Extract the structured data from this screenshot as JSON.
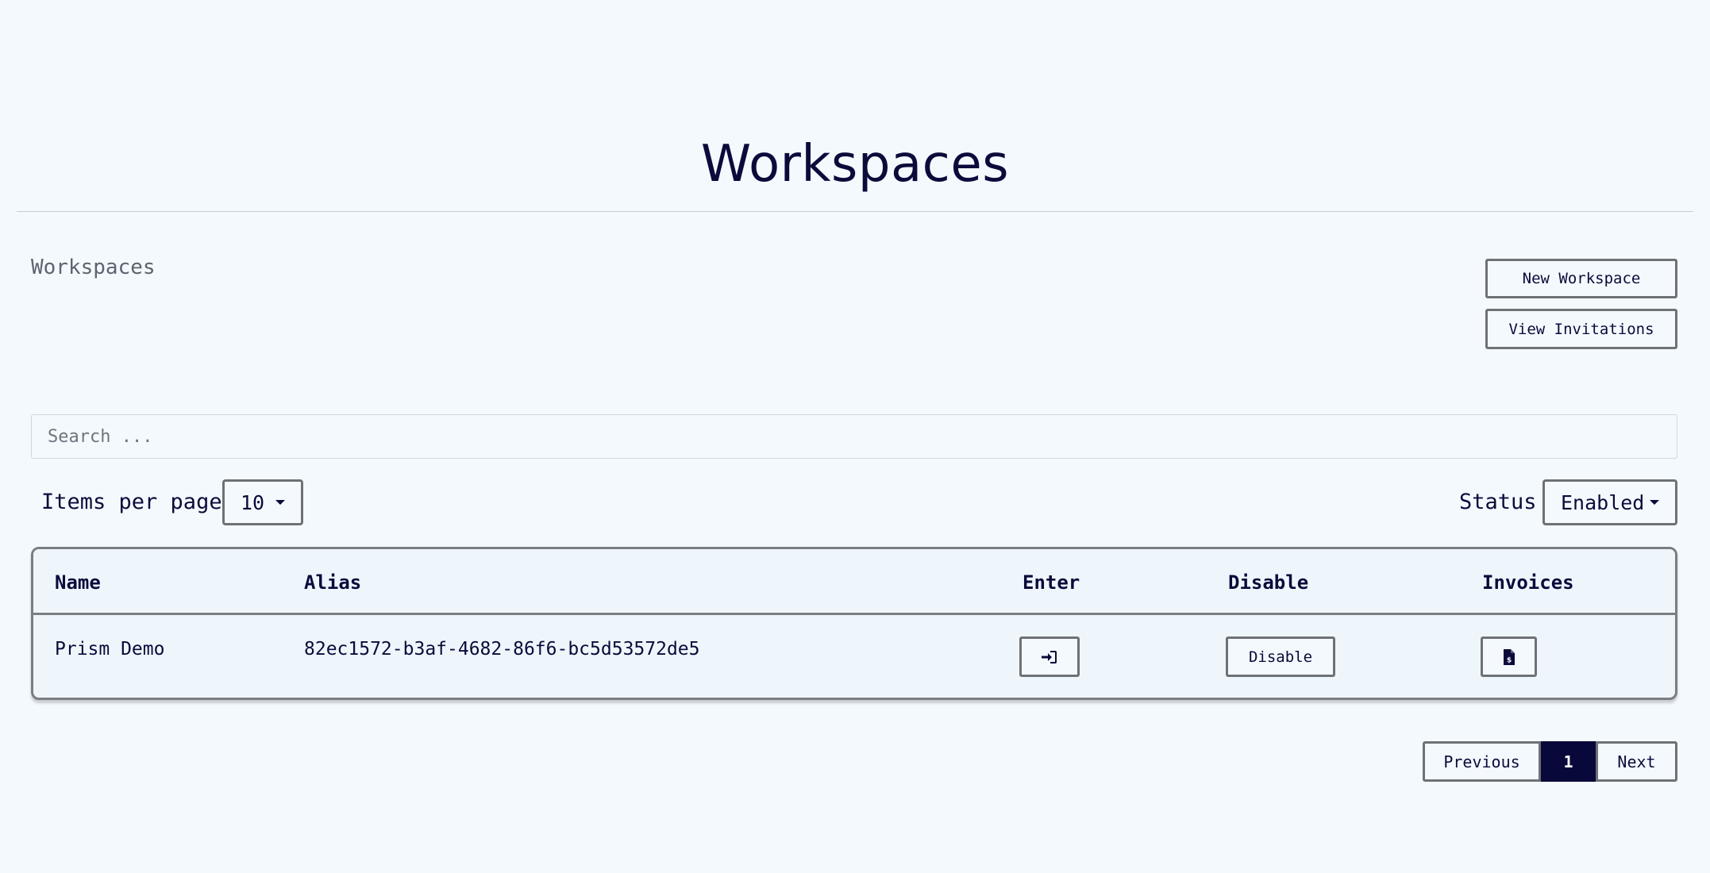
{
  "header": {
    "title": "Workspaces"
  },
  "section": {
    "label": "Workspaces"
  },
  "actions": {
    "new_workspace": "New Workspace",
    "view_invitations": "View Invitations"
  },
  "search": {
    "placeholder": "Search ...",
    "value": ""
  },
  "filters": {
    "items_per_page_label": "Items per page",
    "items_per_page_value": "10",
    "status_label": "Status",
    "status_value": "Enabled"
  },
  "table": {
    "columns": [
      "Name",
      "Alias",
      "Enter",
      "Disable",
      "Invoices"
    ],
    "rows": [
      {
        "name": "Prism Demo",
        "alias": "82ec1572-b3af-4682-86f6-bc5d53572de5",
        "enter_icon": "sign-in-icon",
        "disable_label": "Disable",
        "invoice_icon": "invoice-dollar-icon"
      }
    ]
  },
  "pagination": {
    "previous": "Previous",
    "current": "1",
    "next": "Next"
  },
  "colors": {
    "background": "#f4f9fd",
    "text": "#0b0b3b",
    "border": "#6e7176",
    "active_page": "#08083a"
  }
}
